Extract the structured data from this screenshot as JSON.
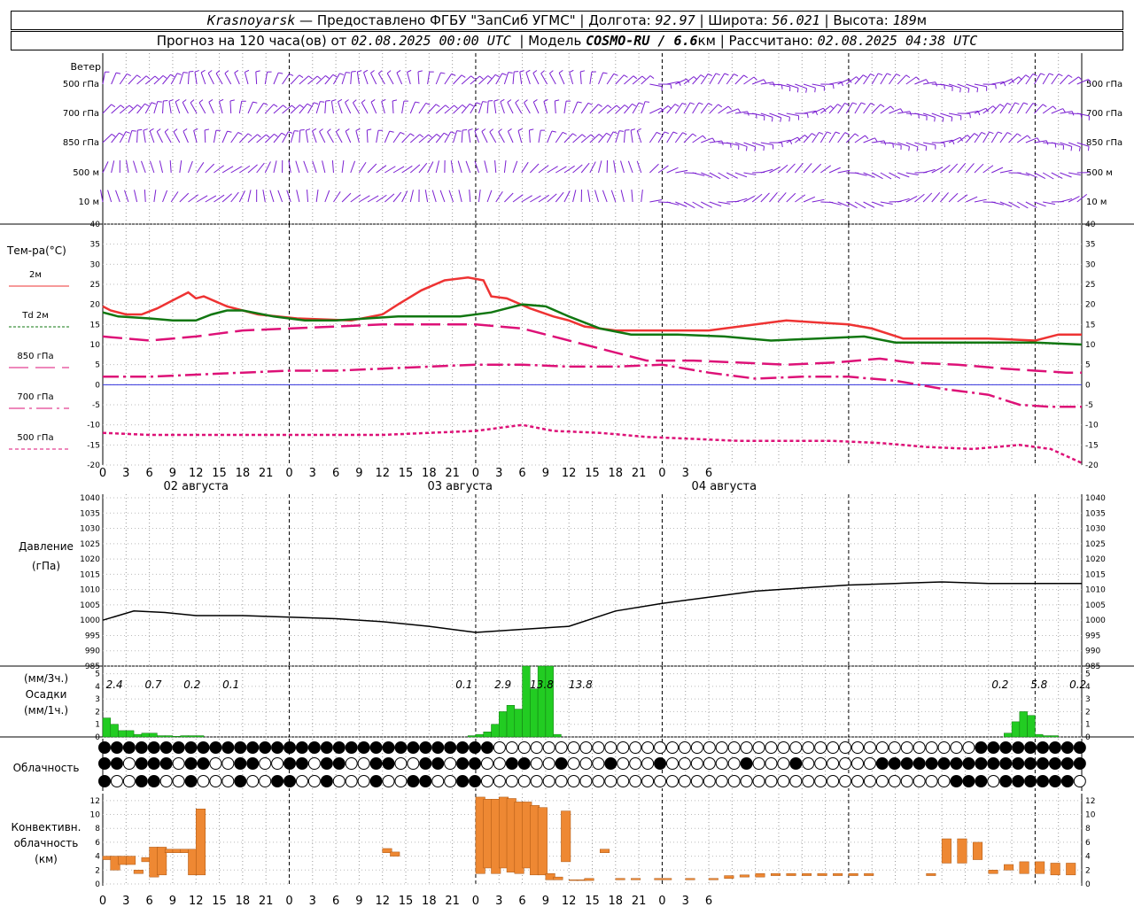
{
  "header": {
    "city": "Krasnoyarsk",
    "provider": "Предоставлено ФГБУ \"ЗапСиб УГМС\"",
    "lon_label": "Долгота:",
    "lon": "92.97",
    "lat_label": "Широта:",
    "lat": "56.021",
    "alt_label": "Высота:",
    "alt": "189",
    "alt_unit": "м",
    "forecast_prefix": "Прогноз на 120 часа(ов) от",
    "start": "02.08.2025 00:00 UTC",
    "model_label": "Модель",
    "model": "COSMO-RU / 6.6",
    "model_unit": "км",
    "calc_label": "Рассчитано:",
    "calc": "02.08.2025 04:38 UTC"
  },
  "panels": {
    "wind": {
      "title": "Ветер",
      "levels": [
        "500 гПа",
        "700 гПа",
        "850 гПа",
        "500 м",
        "10  м"
      ]
    },
    "temp": {
      "title": "Тем-ра(°C)",
      "legend": [
        {
          "label": "2м",
          "color": "#ee3333"
        },
        {
          "label": "Td  2м",
          "color": "#117711"
        },
        {
          "label": "850 гПа",
          "color": "#dd1177"
        },
        {
          "label": "700 гПа",
          "color": "#dd1177"
        },
        {
          "label": "500 гПа",
          "color": "#dd1177"
        }
      ]
    },
    "pres": {
      "title": [
        "Давление",
        "(гПа)"
      ]
    },
    "prec": {
      "title": [
        "(мм/3ч.)",
        "Осадки",
        "(мм/1ч.)"
      ]
    },
    "cloud": {
      "title": "Облачность"
    },
    "conv": {
      "title": [
        "Конвективн.",
        "облачность",
        "(км)"
      ]
    }
  },
  "hour_labels": [
    "0",
    "3",
    "6",
    "9",
    "12",
    "15",
    "18",
    "21",
    "0",
    "3",
    "6",
    "9",
    "12",
    "15",
    "18",
    "21",
    "0",
    "3",
    "6",
    "9",
    "12",
    "15",
    "18",
    "21",
    "0",
    "3",
    "6"
  ],
  "dates": [
    "02 августа",
    "03 августа",
    "04 августа"
  ],
  "chart_data": {
    "type": "line",
    "x_hours": [
      0,
      126
    ],
    "temp_axis": {
      "ylim": [
        -20,
        40
      ],
      "ticks": [
        "40",
        "35",
        "30",
        "25",
        "20",
        "15",
        "10",
        "5",
        "0",
        "-5",
        "-10",
        "-15",
        "-20"
      ]
    },
    "pres_axis": {
      "ylim": [
        985,
        1040
      ],
      "ticks": [
        "1040",
        "1035",
        "1030",
        "1025",
        "1020",
        "1015",
        "1010",
        "1005",
        "1000",
        "995",
        "990",
        "985"
      ]
    },
    "prec_axis": {
      "ylim": [
        0,
        5.6
      ],
      "ticks": [
        "5",
        "4",
        "3",
        "2",
        "1",
        "0"
      ]
    },
    "conv_axis": {
      "ylim": [
        0,
        13
      ],
      "ticks": [
        "12",
        "10",
        "8",
        "6",
        "4",
        "2",
        "0"
      ]
    },
    "series": [
      {
        "name": "2м",
        "color": "#ee3333",
        "points": [
          [
            0,
            19.5
          ],
          [
            1,
            18.5
          ],
          [
            3,
            17.5
          ],
          [
            5,
            17.5
          ],
          [
            7,
            19
          ],
          [
            9,
            21
          ],
          [
            11,
            23
          ],
          [
            12,
            21.5
          ],
          [
            13,
            22
          ],
          [
            16,
            19.5
          ],
          [
            20,
            17.5
          ],
          [
            25,
            16.5
          ],
          [
            32,
            16
          ],
          [
            36,
            17.5
          ],
          [
            38,
            20
          ],
          [
            41,
            23.5
          ],
          [
            44,
            26
          ],
          [
            47,
            26.7
          ],
          [
            49,
            26
          ],
          [
            50,
            22
          ],
          [
            52,
            21.5
          ],
          [
            55,
            19
          ],
          [
            58,
            17
          ],
          [
            60,
            16
          ],
          [
            62,
            14.5
          ],
          [
            66,
            13.5
          ],
          [
            72,
            13.5
          ],
          [
            78,
            13.5
          ],
          [
            84,
            15
          ],
          [
            88,
            16
          ],
          [
            92,
            15.5
          ],
          [
            96,
            15
          ],
          [
            99,
            14
          ],
          [
            103,
            11.5
          ],
          [
            108,
            11.5
          ],
          [
            114,
            11.5
          ],
          [
            120,
            11
          ],
          [
            123,
            12.5
          ],
          [
            126,
            12.5
          ]
        ]
      },
      {
        "name": "Td 2м",
        "color": "#117711",
        "points": [
          [
            0,
            18
          ],
          [
            2,
            17
          ],
          [
            6,
            16.5
          ],
          [
            9,
            16
          ],
          [
            12,
            16
          ],
          [
            14,
            17.5
          ],
          [
            16,
            18.5
          ],
          [
            18,
            18.5
          ],
          [
            22,
            17
          ],
          [
            26,
            16
          ],
          [
            30,
            16
          ],
          [
            34,
            16.5
          ],
          [
            38,
            17
          ],
          [
            42,
            17
          ],
          [
            46,
            17
          ],
          [
            50,
            18
          ],
          [
            54,
            20
          ],
          [
            57,
            19.5
          ],
          [
            60,
            17
          ],
          [
            64,
            14
          ],
          [
            68,
            12.5
          ],
          [
            74,
            12.5
          ],
          [
            80,
            12
          ],
          [
            86,
            11
          ],
          [
            92,
            11.5
          ],
          [
            98,
            12
          ],
          [
            102,
            10.5
          ],
          [
            106,
            10.5
          ],
          [
            114,
            10.5
          ],
          [
            120,
            10.5
          ],
          [
            126,
            10
          ]
        ]
      },
      {
        "name": "850 гПа",
        "color": "#dd1177",
        "dash": "22 8",
        "points": [
          [
            0,
            12
          ],
          [
            6,
            11
          ],
          [
            12,
            12
          ],
          [
            18,
            13.5
          ],
          [
            24,
            14
          ],
          [
            30,
            14.5
          ],
          [
            36,
            15
          ],
          [
            42,
            15
          ],
          [
            48,
            15
          ],
          [
            54,
            14
          ],
          [
            58,
            12
          ],
          [
            62,
            10
          ],
          [
            66,
            8
          ],
          [
            70,
            6
          ],
          [
            76,
            6
          ],
          [
            82,
            5.5
          ],
          [
            88,
            5
          ],
          [
            94,
            5.5
          ],
          [
            100,
            6.5
          ],
          [
            104,
            5.5
          ],
          [
            110,
            5
          ],
          [
            116,
            4
          ],
          [
            120,
            3.5
          ],
          [
            124,
            3
          ],
          [
            126,
            3
          ]
        ]
      },
      {
        "name": "700 гПа",
        "color": "#dd1177",
        "dash": "18 5 3 5",
        "points": [
          [
            0,
            2
          ],
          [
            6,
            2
          ],
          [
            12,
            2.5
          ],
          [
            18,
            3
          ],
          [
            24,
            3.5
          ],
          [
            30,
            3.5
          ],
          [
            36,
            4
          ],
          [
            42,
            4.5
          ],
          [
            48,
            5
          ],
          [
            54,
            5
          ],
          [
            60,
            4.5
          ],
          [
            66,
            4.5
          ],
          [
            72,
            5
          ],
          [
            78,
            3
          ],
          [
            84,
            1.5
          ],
          [
            90,
            2
          ],
          [
            96,
            2
          ],
          [
            102,
            1
          ],
          [
            108,
            -1
          ],
          [
            114,
            -2.5
          ],
          [
            118,
            -5
          ],
          [
            122,
            -5.5
          ],
          [
            126,
            -5.5
          ]
        ]
      },
      {
        "name": "500 гПа",
        "color": "#dd1177",
        "dash": "4 3",
        "points": [
          [
            0,
            -12
          ],
          [
            6,
            -12.5
          ],
          [
            12,
            -12.5
          ],
          [
            18,
            -12.5
          ],
          [
            24,
            -12.5
          ],
          [
            30,
            -12.5
          ],
          [
            36,
            -12.5
          ],
          [
            42,
            -12
          ],
          [
            48,
            -11.5
          ],
          [
            54,
            -10
          ],
          [
            58,
            -11.5
          ],
          [
            64,
            -12
          ],
          [
            70,
            -13
          ],
          [
            76,
            -13.5
          ],
          [
            82,
            -14
          ],
          [
            88,
            -14
          ],
          [
            94,
            -14
          ],
          [
            100,
            -14.5
          ],
          [
            106,
            -15.5
          ],
          [
            112,
            -16
          ],
          [
            118,
            -15
          ],
          [
            122,
            -16
          ],
          [
            126,
            -19.5
          ]
        ]
      },
      {
        "name": "pressure",
        "color": "#000000",
        "points": [
          [
            0,
            1000
          ],
          [
            4,
            1003
          ],
          [
            8,
            1002.5
          ],
          [
            12,
            1001.5
          ],
          [
            18,
            1001.5
          ],
          [
            24,
            1001
          ],
          [
            30,
            1000.5
          ],
          [
            36,
            999.5
          ],
          [
            42,
            998
          ],
          [
            48,
            996
          ],
          [
            54,
            997
          ],
          [
            60,
            998
          ],
          [
            66,
            1003
          ],
          [
            72,
            1005.5
          ],
          [
            78,
            1007.5
          ],
          [
            84,
            1009.5
          ],
          [
            90,
            1010.5
          ],
          [
            96,
            1011.5
          ],
          [
            102,
            1012
          ],
          [
            108,
            1012.5
          ],
          [
            114,
            1012
          ],
          [
            120,
            1012
          ],
          [
            126,
            1012
          ]
        ]
      }
    ],
    "precip_bars": [
      [
        0,
        1.5
      ],
      [
        1,
        1
      ],
      [
        2,
        0.5
      ],
      [
        3,
        0.5
      ],
      [
        4,
        0.2
      ],
      [
        5,
        0.3
      ],
      [
        6,
        0.3
      ],
      [
        7,
        0.1
      ],
      [
        8,
        0.1
      ],
      [
        9,
        0.05
      ],
      [
        10,
        0.1
      ],
      [
        11,
        0.1
      ],
      [
        12,
        0.1
      ],
      [
        47,
        0.1
      ],
      [
        48,
        0.2
      ],
      [
        49,
        0.4
      ],
      [
        50,
        1
      ],
      [
        51,
        2
      ],
      [
        52,
        2.5
      ],
      [
        53,
        2.2
      ],
      [
        54,
        5.6
      ],
      [
        55,
        3.8
      ],
      [
        56,
        5.6
      ],
      [
        57,
        5.6
      ],
      [
        58,
        0.2
      ],
      [
        116,
        0.3
      ],
      [
        117,
        1.2
      ],
      [
        118,
        2
      ],
      [
        119,
        1.7
      ],
      [
        120,
        0.2
      ],
      [
        121,
        0.1
      ],
      [
        122,
        0.1
      ]
    ],
    "precip_labels": [
      [
        1.5,
        "2.4"
      ],
      [
        6.5,
        "0.7"
      ],
      [
        11.5,
        "0.2"
      ],
      [
        16.5,
        "0.1"
      ],
      [
        46.5,
        "0.1"
      ],
      [
        51.5,
        "2.9"
      ],
      [
        56.5,
        "13.8"
      ],
      [
        61.5,
        "13.8"
      ],
      [
        115.5,
        "0.2"
      ],
      [
        120.5,
        "5.8"
      ],
      [
        125.5,
        "0.2"
      ]
    ],
    "conv_bars": [
      [
        0,
        3.5,
        4
      ],
      [
        1,
        2,
        4
      ],
      [
        2,
        2.8,
        4
      ],
      [
        3,
        2.8,
        4
      ],
      [
        4,
        1.5,
        2
      ],
      [
        5,
        3.2,
        3.8
      ],
      [
        6,
        1,
        5.3
      ],
      [
        7,
        1.3,
        5.3
      ],
      [
        8,
        4.5,
        5
      ],
      [
        9,
        4.5,
        5
      ],
      [
        10,
        4.5,
        5
      ],
      [
        11,
        1.3,
        5
      ],
      [
        12,
        1.3,
        10.8
      ],
      [
        36,
        4.5,
        5.1
      ],
      [
        37,
        4,
        4.6
      ],
      [
        48,
        1.5,
        12.5
      ],
      [
        49,
        2.3,
        12.2
      ],
      [
        50,
        1.5,
        12.2
      ],
      [
        51,
        2.3,
        12.5
      ],
      [
        52,
        1.7,
        12.3
      ],
      [
        53,
        1.5,
        11.8
      ],
      [
        54,
        2.3,
        11.8
      ],
      [
        55,
        1.3,
        11.3
      ],
      [
        56,
        1.3,
        11
      ],
      [
        57,
        0.6,
        1.5
      ],
      [
        58,
        0.6,
        1
      ],
      [
        59,
        3.2,
        10.5
      ],
      [
        60,
        0.5,
        0.6
      ],
      [
        61,
        0.5,
        0.6
      ],
      [
        62,
        0.5,
        0.8
      ],
      [
        64,
        4.5,
        5
      ],
      [
        66,
        0.6,
        0.8
      ],
      [
        68,
        0.6,
        0.8
      ],
      [
        71,
        0.6,
        0.8
      ],
      [
        72,
        0.6,
        0.8
      ],
      [
        75,
        0.6,
        0.8
      ],
      [
        78,
        0.6,
        0.8
      ],
      [
        80,
        0.8,
        1.2
      ],
      [
        82,
        1,
        1.3
      ],
      [
        84,
        1,
        1.5
      ],
      [
        86,
        1.2,
        1.5
      ],
      [
        88,
        1.2,
        1.5
      ],
      [
        90,
        1.2,
        1.5
      ],
      [
        92,
        1.2,
        1.5
      ],
      [
        94,
        1.2,
        1.5
      ],
      [
        96,
        1.2,
        1.5
      ],
      [
        98,
        1.2,
        1.5
      ],
      [
        106,
        1.2,
        1.5
      ],
      [
        108,
        3,
        6.5
      ],
      [
        110,
        3,
        6.5
      ],
      [
        112,
        3.5,
        6
      ],
      [
        114,
        1.5,
        2
      ],
      [
        116,
        2,
        2.8
      ],
      [
        118,
        1.5,
        3.2
      ],
      [
        120,
        1.5,
        3.2
      ],
      [
        122,
        1.3,
        3
      ],
      [
        124,
        1.3,
        3
      ]
    ]
  }
}
